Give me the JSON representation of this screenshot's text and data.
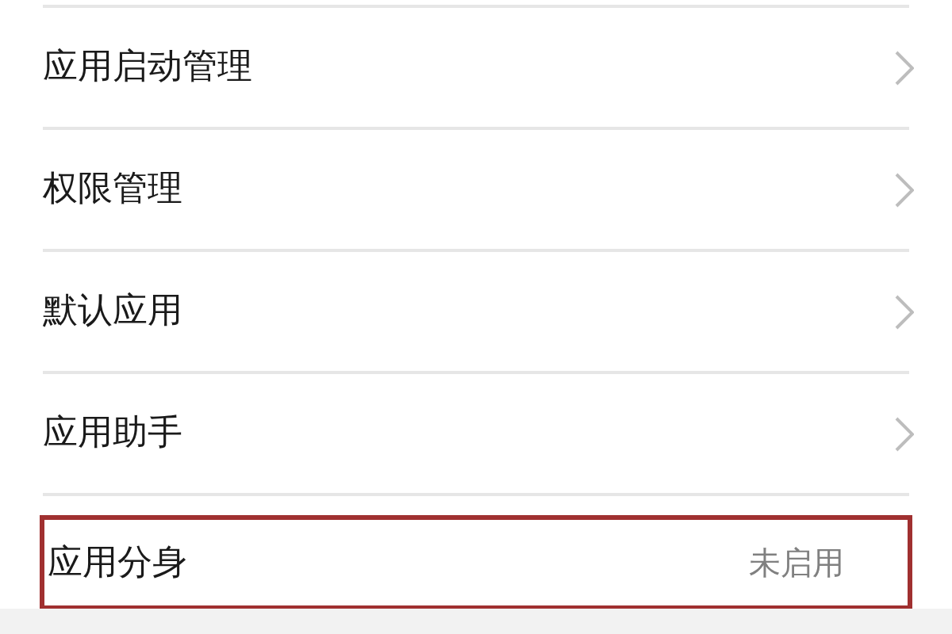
{
  "settings_items": [
    {
      "label": "应用启动管理",
      "kind": "link",
      "highlighted": false
    },
    {
      "label": "权限管理",
      "kind": "link",
      "highlighted": false
    },
    {
      "label": "默认应用",
      "kind": "link",
      "highlighted": false
    },
    {
      "label": "应用助手",
      "kind": "link",
      "highlighted": false
    },
    {
      "label": "应用分身",
      "kind": "value",
      "value": "未启用",
      "highlighted": true
    }
  ]
}
